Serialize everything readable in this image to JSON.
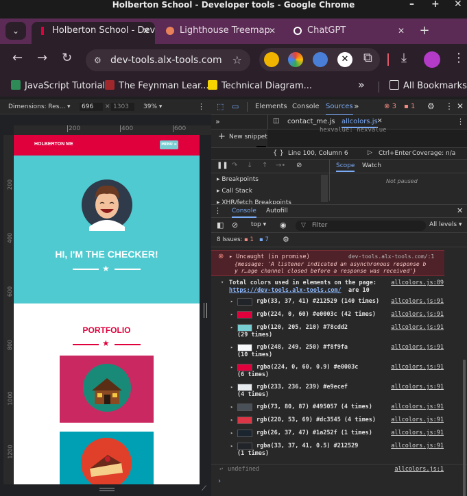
{
  "window": {
    "title": "Holberton School - Developer tools - Google Chrome"
  },
  "tabs": [
    {
      "label": "Holberton School - Dev",
      "fav_color": "#e0003c"
    },
    {
      "label": "Lighthouse Treemap",
      "fav_color": "#e8805a"
    },
    {
      "label": "ChatGPT",
      "fav_color": "#ffffff"
    }
  ],
  "toolbar": {
    "url": "dev-tools.alx-tools.com"
  },
  "bookmarks": {
    "items": [
      {
        "label": "JavaScript Tutorial",
        "color": "#2e8b57"
      },
      {
        "label": "The Feynman Lear...",
        "color": "#a0282c"
      },
      {
        "label": "Technical Diagram...",
        "color": "#f5d400"
      }
    ],
    "more": "»",
    "all": "All Bookmarks"
  },
  "device_toolbar": {
    "dimensions": "Dimensions: Res...",
    "width": "696",
    "height": "1303",
    "zoom": "39%"
  },
  "rulers": {
    "top": [
      "200",
      "400",
      "600"
    ],
    "left": [
      "200",
      "400",
      "600",
      "800",
      "1000",
      "1200"
    ]
  },
  "page": {
    "brand": "HOLBERTON ME",
    "menu": "MENU ≡",
    "hero_title": "HI, I'M THE CHECKER!",
    "portfolio_title": "PORTFOLIO"
  },
  "devtools": {
    "tabs": [
      "Elements",
      "Console",
      "Sources"
    ],
    "selected_tab": "Sources",
    "errors": "3",
    "warnings": "1",
    "file_tabs": [
      "contact_me.js",
      "allcolors.js"
    ],
    "new_snippet": "New snippet",
    "position": "Line 100, Column 6",
    "run_hint": "Ctrl+Enter",
    "coverage": "Coverage: n/a",
    "panes": [
      "Breakpoints",
      "Call Stack",
      "XHR/fetch Breakpoints"
    ],
    "side_tabs": [
      "Scope",
      "Watch"
    ],
    "not_paused": "Not paused",
    "drawer_tabs": [
      "Console",
      "Autofill"
    ],
    "context": "top",
    "filter_placeholder": "Filter",
    "levels": "All levels",
    "issues_label": "8 Issues:",
    "issues_errors": "1",
    "issues_info": "7"
  },
  "console": {
    "error": {
      "title": "Uncaught (in promise)",
      "source": "dev-tools.alx-tools.com/:1",
      "line1": "{message: 'A listener indicated an asynchronous response b",
      "line2": "y r…age channel closed before a response was received'}"
    },
    "summary": {
      "text": "Total colors used in elements on the page:",
      "url": "https://dev-tools.alx-tools.com/",
      "suffix": "are 10",
      "source": "allcolors.js:89"
    },
    "rows": [
      {
        "text": "rgb(33, 37, 41) #212529 (140 times)",
        "wrap": "",
        "color": "#212529",
        "source": "allcolors.js:91"
      },
      {
        "text": "rgb(224, 0, 60) #e0003c (42 times)",
        "wrap": "",
        "color": "#e0003c",
        "source": "allcolors.js:91"
      },
      {
        "text": "rgb(120, 205, 210) #78cdd2",
        "wrap": "(29 times)",
        "color": "#78cdd2",
        "source": "allcolors.js:91"
      },
      {
        "text": "rgb(248, 249, 250) #f8f9fa",
        "wrap": "(10 times)",
        "color": "#f8f9fa",
        "source": "allcolors.js:91"
      },
      {
        "text": "rgba(224, 0, 60, 0.9) #e0003c",
        "wrap": "(6 times)",
        "color": "#e0003c",
        "source": "allcolors.js:91"
      },
      {
        "text": "rgb(233, 236, 239) #e9ecef",
        "wrap": "(4 times)",
        "color": "#e9ecef",
        "source": "allcolors.js:91"
      },
      {
        "text": "rgb(73, 80, 87) #495057 (4 times)",
        "wrap": "",
        "color": "#495057",
        "source": "allcolors.js:91"
      },
      {
        "text": "rgb(220, 53, 69) #dc3545 (4 times)",
        "wrap": "",
        "color": "#dc3545",
        "source": "allcolors.js:91"
      },
      {
        "text": "rgb(26, 37, 47) #1a252f (1 times)",
        "wrap": "",
        "color": "#1a252f",
        "source": "allcolors.js:91"
      },
      {
        "text": "rgba(33, 37, 41, 0.5) #212529",
        "wrap": "(1 times)",
        "color": "#212529",
        "source": "allcolors.js:91"
      }
    ],
    "undefined_text": "undefined",
    "undefined_source": "allcolors.js:1"
  }
}
